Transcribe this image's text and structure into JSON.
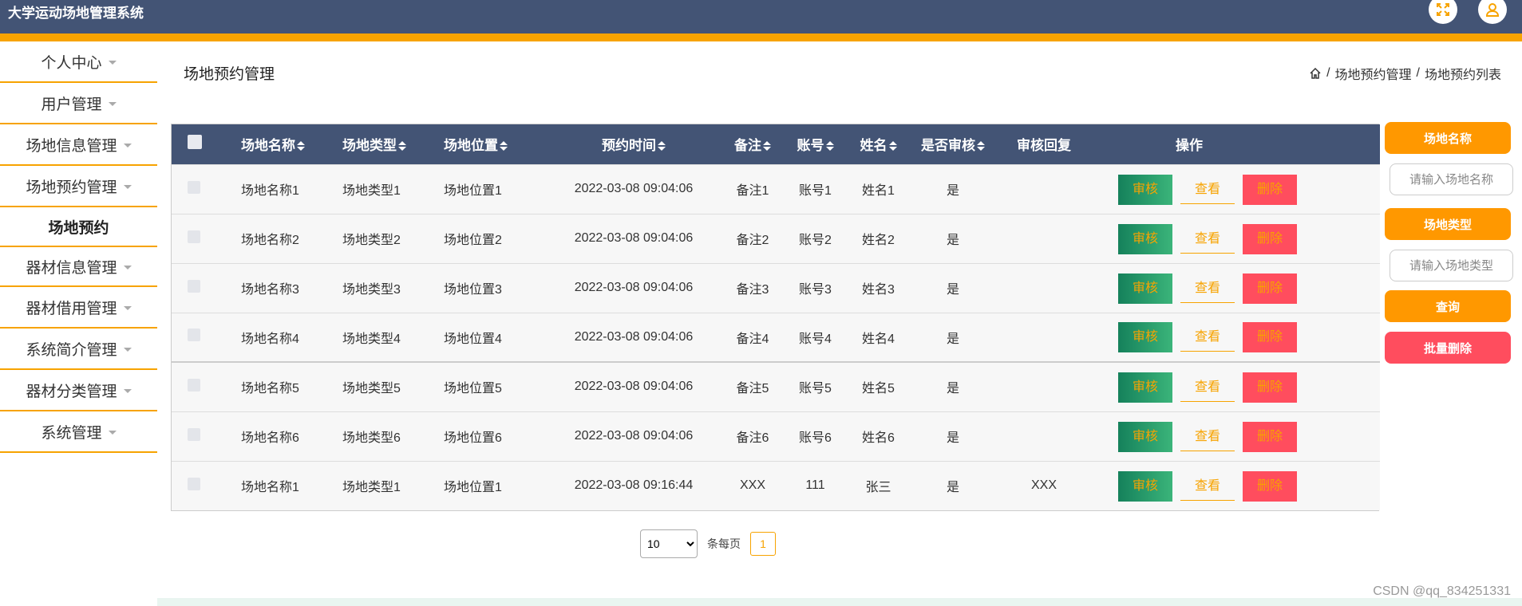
{
  "app": {
    "title": "大学运动场地管理系统"
  },
  "sidebar": {
    "items": [
      {
        "label": "个人中心"
      },
      {
        "label": "用户管理"
      },
      {
        "label": "场地信息管理"
      },
      {
        "label": "场地预约管理"
      },
      {
        "label": "器材信息管理"
      },
      {
        "label": "器材借用管理"
      },
      {
        "label": "系统简介管理"
      },
      {
        "label": "器材分类管理"
      },
      {
        "label": "系统管理"
      }
    ],
    "active_sub": "场地预约"
  },
  "page": {
    "title": "场地预约管理",
    "breadcrumb": [
      "场地预约管理",
      "场地预约列表"
    ],
    "breadcrumb_sep": "/"
  },
  "table": {
    "headers": [
      "场地名称",
      "场地类型",
      "场地位置",
      "预约时间",
      "备注",
      "账号",
      "姓名",
      "是否审核",
      "审核回复",
      "操作"
    ],
    "actions": {
      "audit": "审核",
      "view": "查看",
      "delete": "删除"
    },
    "rows": [
      {
        "name": "场地名称1",
        "type": "场地类型1",
        "location": "场地位置1",
        "time": "2022-03-08 09:04:06",
        "note": "备注1",
        "account": "账号1",
        "person": "姓名1",
        "audited": "是",
        "reply": ""
      },
      {
        "name": "场地名称2",
        "type": "场地类型2",
        "location": "场地位置2",
        "time": "2022-03-08 09:04:06",
        "note": "备注2",
        "account": "账号2",
        "person": "姓名2",
        "audited": "是",
        "reply": ""
      },
      {
        "name": "场地名称3",
        "type": "场地类型3",
        "location": "场地位置3",
        "time": "2022-03-08 09:04:06",
        "note": "备注3",
        "account": "账号3",
        "person": "姓名3",
        "audited": "是",
        "reply": ""
      },
      {
        "name": "场地名称4",
        "type": "场地类型4",
        "location": "场地位置4",
        "time": "2022-03-08 09:04:06",
        "note": "备注4",
        "account": "账号4",
        "person": "姓名4",
        "audited": "是",
        "reply": ""
      },
      {
        "name": "场地名称5",
        "type": "场地类型5",
        "location": "场地位置5",
        "time": "2022-03-08 09:04:06",
        "note": "备注5",
        "account": "账号5",
        "person": "姓名5",
        "audited": "是",
        "reply": ""
      },
      {
        "name": "场地名称6",
        "type": "场地类型6",
        "location": "场地位置6",
        "time": "2022-03-08 09:04:06",
        "note": "备注6",
        "account": "账号6",
        "person": "姓名6",
        "audited": "是",
        "reply": ""
      },
      {
        "name": "场地名称1",
        "type": "场地类型1",
        "location": "场地位置1",
        "time": "2022-03-08 09:16:44",
        "note": "XXX",
        "account": "111",
        "person": "张三",
        "audited": "是",
        "reply": "XXX"
      }
    ]
  },
  "search": {
    "venue_name_label": "场地名称",
    "venue_name_placeholder": "请输入场地名称",
    "venue_type_label": "场地类型",
    "venue_type_placeholder": "请输入场地类型",
    "query_button": "查询",
    "batch_delete_button": "批量删除"
  },
  "pagination": {
    "page_size": "10",
    "page_size_suffix": "条每页",
    "current_page": "1"
  },
  "watermark": "CSDN @qq_834251331",
  "colors": {
    "header": "#435475",
    "accent": "#f7a300",
    "orange": "#ff9800",
    "danger": "#ff4d5e"
  },
  "icons": {
    "fullscreen": "expand-icon",
    "user": "user-icon",
    "home": "home-icon",
    "sort": "sort-icon"
  }
}
